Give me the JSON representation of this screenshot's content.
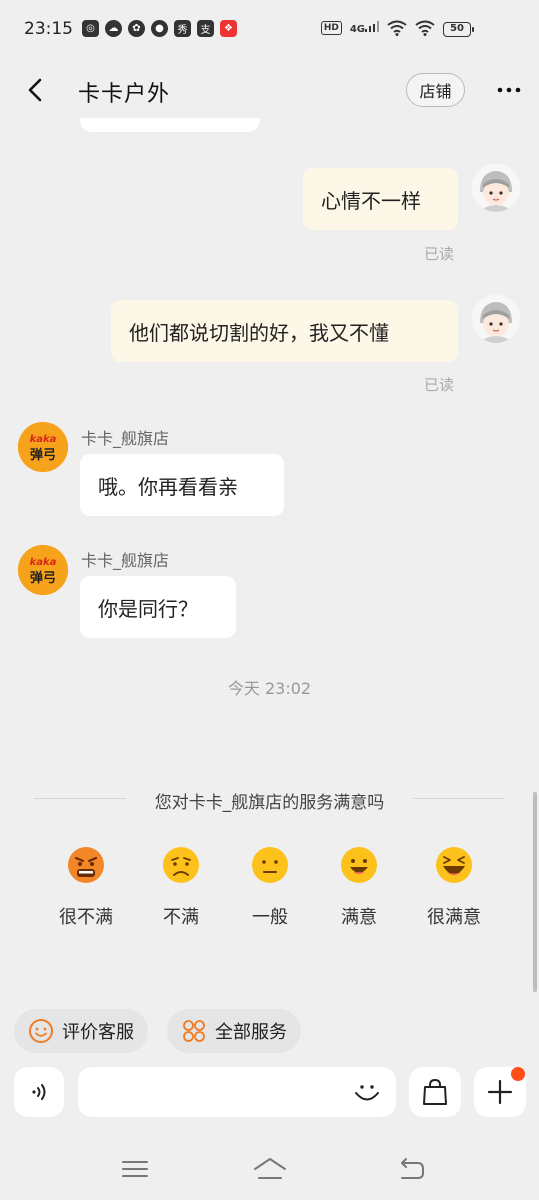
{
  "status_bar": {
    "time": "23:15",
    "hd": "HD",
    "signal": "4G",
    "battery": "50"
  },
  "header": {
    "title": "卡卡户外",
    "store_label": "店铺"
  },
  "messages": [
    {
      "from": "me",
      "text": "心情不一样",
      "status": "已读"
    },
    {
      "from": "me",
      "text": "他们都说切割的好，我又不懂",
      "status": "已读"
    },
    {
      "from": "shop",
      "sender": "卡卡_舰旗店",
      "text": "哦。你再看看亲"
    },
    {
      "from": "shop",
      "sender": "卡卡_舰旗店",
      "text": "你是同行？"
    }
  ],
  "shop_avatar": {
    "brand": "kaka",
    "sub": "弹弓"
  },
  "timestamp": "今天  23:02",
  "survey": {
    "title": "您对卡卡_舰旗店的服务满意吗",
    "options": [
      {
        "label": "很不满",
        "icon": "angry-face-icon"
      },
      {
        "label": "不满",
        "icon": "frown-face-icon"
      },
      {
        "label": "一般",
        "icon": "neutral-face-icon"
      },
      {
        "label": "满意",
        "icon": "smile-face-icon"
      },
      {
        "label": "很满意",
        "icon": "laugh-face-icon"
      }
    ]
  },
  "quick_actions": [
    {
      "label": "评价客服",
      "icon": "smiley-outline-icon"
    },
    {
      "label": "全部服务",
      "icon": "grid-flower-icon"
    }
  ],
  "colors": {
    "accent": "#f07b22",
    "my_bubble": "#fdf7e7",
    "badge": "#ff4e1a"
  }
}
